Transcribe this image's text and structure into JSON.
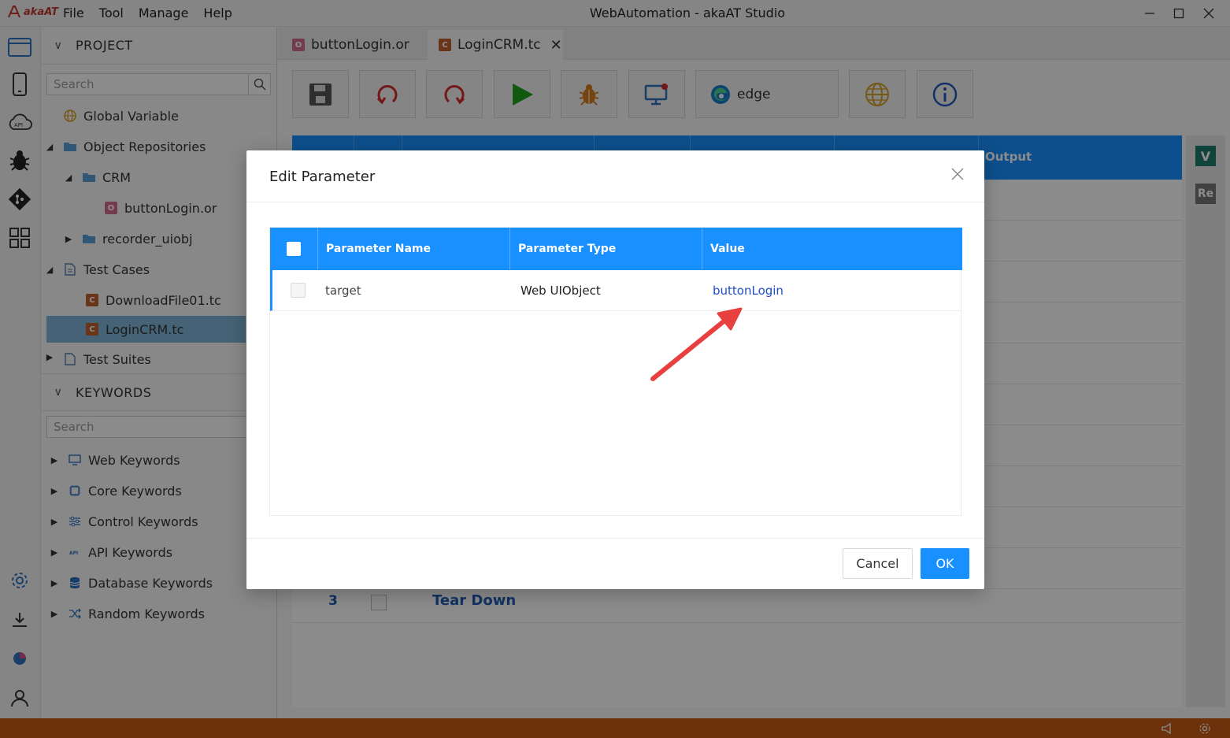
{
  "app": {
    "logo_text": "akaAT",
    "window_title": "WebAutomation - akaAT Studio",
    "menu": [
      "File",
      "Tool",
      "Manage",
      "Help"
    ]
  },
  "sidebar": {
    "project_title": "PROJECT",
    "project_search_placeholder": "Search",
    "tree": [
      {
        "label": "Global Variable"
      },
      {
        "label": "Object Repositories"
      },
      {
        "label": "CRM"
      },
      {
        "label": "buttonLogin.or"
      },
      {
        "label": "recorder_uiobj"
      },
      {
        "label": "Test Cases"
      },
      {
        "label": "DownloadFile01.tc"
      },
      {
        "label": "LoginCRM.tc"
      },
      {
        "label": "Test Suites"
      }
    ],
    "keywords_title": "KEYWORDS",
    "keywords_search_placeholder": "Search",
    "keywords": [
      {
        "label": "Web Keywords"
      },
      {
        "label": "Core Keywords"
      },
      {
        "label": "Control Keywords"
      },
      {
        "label": "API Keywords"
      },
      {
        "label": "Database Keywords"
      },
      {
        "label": "Random Keywords"
      }
    ]
  },
  "editor": {
    "tabs": [
      {
        "label": "buttonLogin.or"
      },
      {
        "label": "LoginCRM.tc"
      }
    ],
    "browser_label": "edge",
    "grid_output_header": "Output",
    "visible_row": {
      "number": "3",
      "name": "Tear Down"
    },
    "right_badges": [
      "V",
      "Re"
    ]
  },
  "modal": {
    "title": "Edit Parameter",
    "columns": [
      "Parameter Name",
      "Parameter Type",
      "Value"
    ],
    "rows": [
      {
        "name": "target",
        "type": "Web UIObject",
        "value": "buttonLogin"
      }
    ],
    "cancel_label": "Cancel",
    "ok_label": "OK"
  },
  "colors": {
    "accent": "#1890ff",
    "status_bar": "#c65c16",
    "annotation_arrow": "#e8403f"
  }
}
